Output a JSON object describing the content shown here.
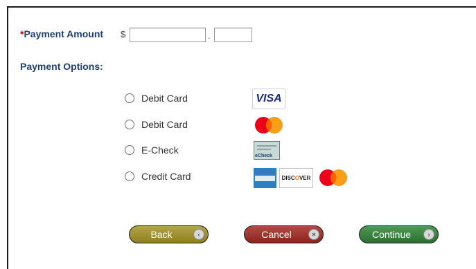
{
  "payment_amount": {
    "required_marker": "*",
    "label": "Payment Amount",
    "currency_symbol": "$",
    "separator": ".",
    "dollars_value": "",
    "cents_value": ""
  },
  "payment_options": {
    "label": "Payment Options:",
    "options": [
      {
        "label": "Debit Card",
        "selected": false,
        "logos": [
          "visa-logo"
        ]
      },
      {
        "label": "Debit Card",
        "selected": false,
        "logos": [
          "mastercard-logo"
        ]
      },
      {
        "label": "E-Check",
        "selected": false,
        "logos": [
          "echeck-logo"
        ],
        "logo_text": "eCheck"
      },
      {
        "label": "Credit Card",
        "selected": false,
        "logos": [
          "amex-logo",
          "discover-logo",
          "mastercard-logo"
        ]
      }
    ],
    "visa_text": "VISA",
    "discover_text_before": "DISC",
    "discover_text_o": "O",
    "discover_text_after": "VER"
  },
  "buttons": {
    "back": {
      "label": "Back",
      "color": "#9f8f2c",
      "icon": "chevron-left-icon",
      "icon_glyph": "‹"
    },
    "cancel": {
      "label": "Cancel",
      "color": "#9c3028",
      "icon": "close-icon",
      "icon_glyph": "×"
    },
    "continue": {
      "label": "Continue",
      "color": "#3d8843",
      "icon": "chevron-right-icon",
      "icon_glyph": "›"
    }
  },
  "colors": {
    "label_blue": "#1f3e72",
    "required_red": "#cc0000",
    "mastercard_red": "#eb001b",
    "mastercard_orange": "#f79e1b"
  }
}
